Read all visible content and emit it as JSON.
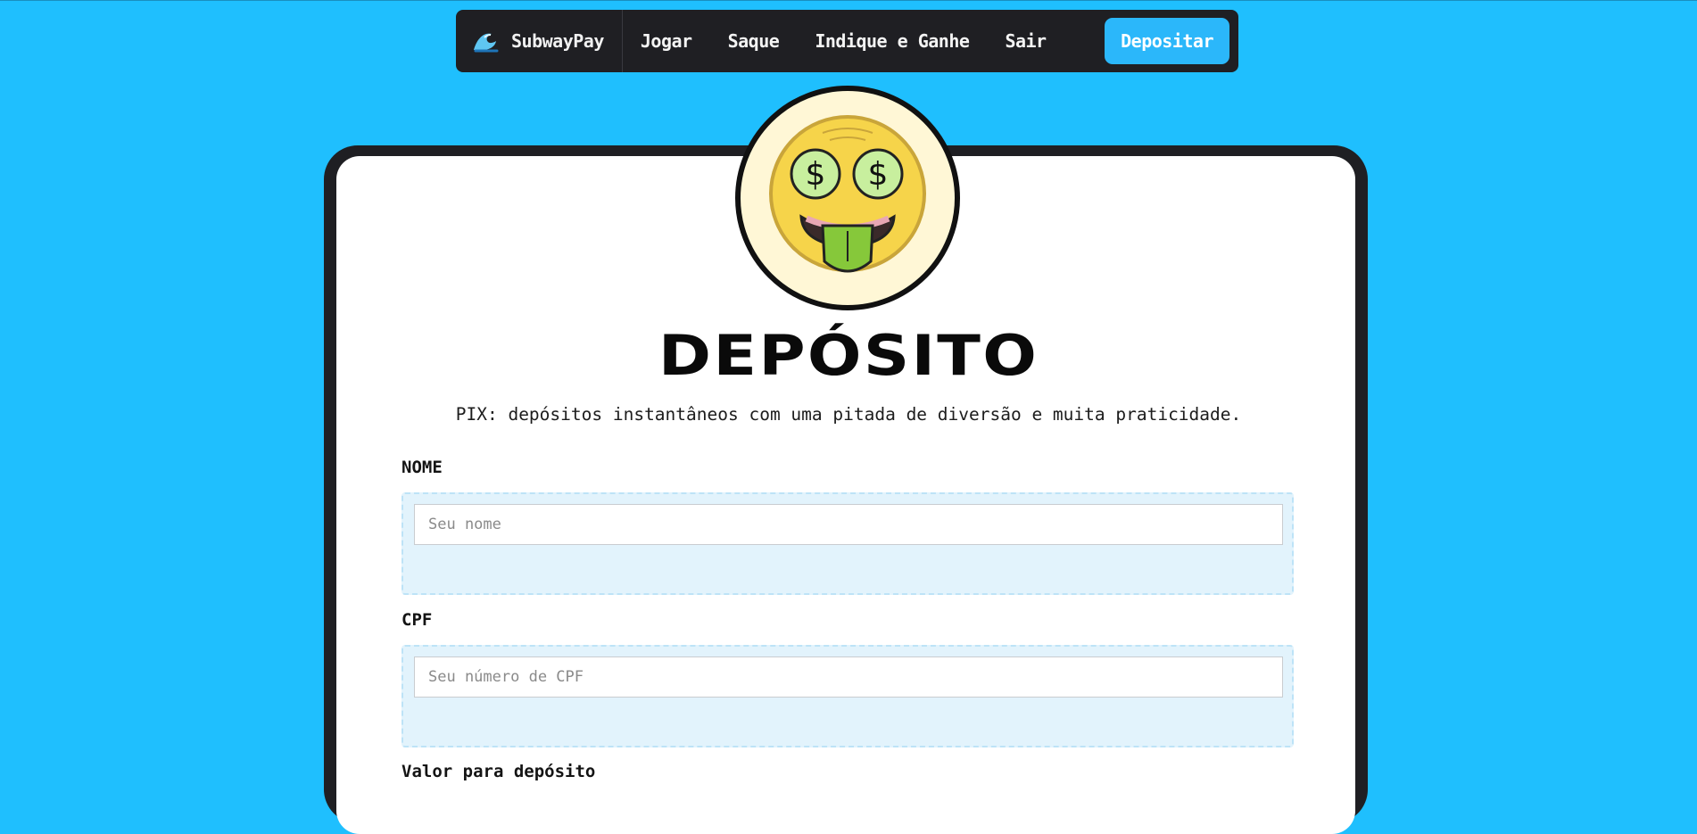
{
  "nav": {
    "brand_label": "SubwayPay",
    "brand_icon": "wave-icon",
    "links": [
      "Jogar",
      "Saque",
      "Indique e Ganhe",
      "Sair"
    ],
    "cta_label": "Depositar"
  },
  "avatar_icon": "money-eyes-tongue-emoji-icon",
  "page": {
    "title": "DEPÓSITO",
    "subtitle": "PIX: depósitos instantâneos com uma pitada de diversão e muita praticidade."
  },
  "form": {
    "name_label": "NOME",
    "name_placeholder": "Seu nome",
    "cpf_label": "CPF",
    "cpf_placeholder": "Seu número de CPF",
    "amount_label": "Valor para depósito"
  },
  "colors": {
    "background": "#1fbffe",
    "nav_bg": "#1f1f23",
    "cta_bg": "#2bb7fa",
    "field_bg": "#e2f3fc"
  }
}
